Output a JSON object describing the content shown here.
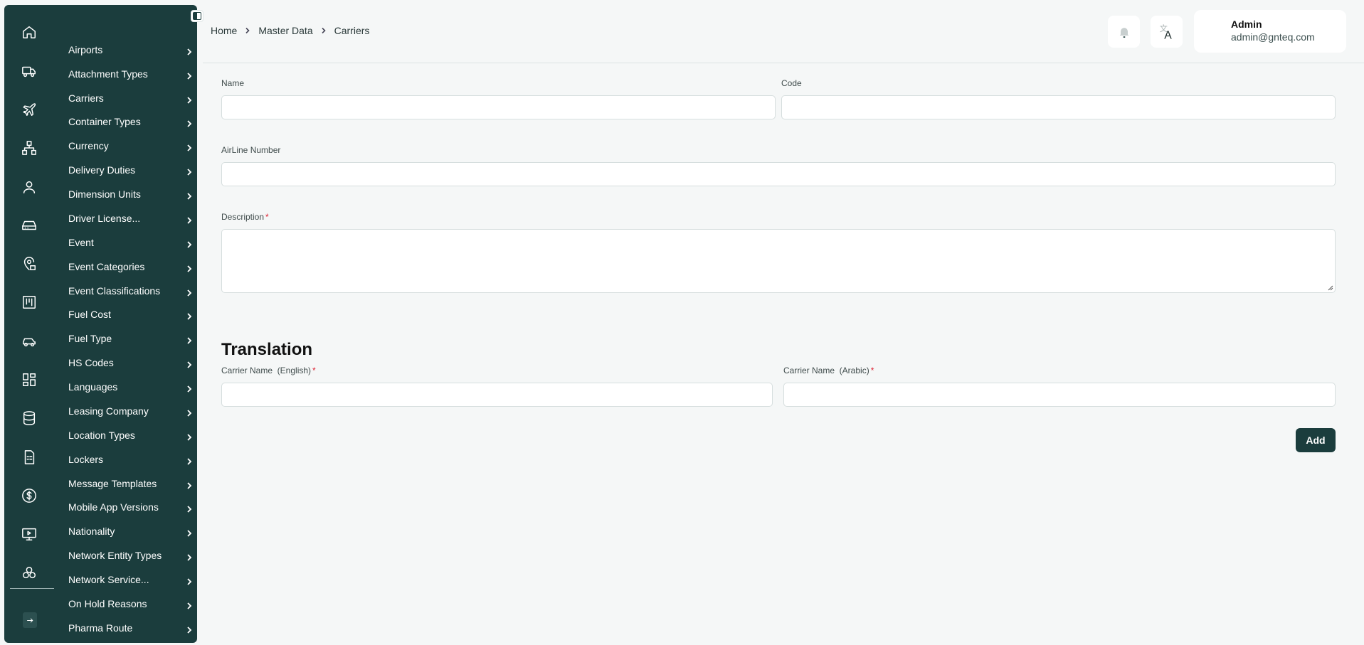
{
  "breadcrumb": {
    "home": "Home",
    "section": "Master Data",
    "current": "Carriers"
  },
  "user": {
    "name": "Admin",
    "email": "admin@gnteq.com"
  },
  "header": {
    "bell_icon": "bell-icon",
    "translate_icon": "translate-icon"
  },
  "sidebar": {
    "rail_icons": [
      "home-icon",
      "truck-icon",
      "plane-icon",
      "network-icon",
      "user-icon",
      "drive-icon",
      "location-pin-icon",
      "kanban-icon",
      "car-icon",
      "grid-icon",
      "database-icon",
      "document-icon",
      "dollar-icon",
      "monitor-icon",
      "cogs-icon",
      "logout-icon"
    ],
    "menu": [
      "Airports",
      "Attachment Types",
      "Carriers",
      "Container Types",
      "Currency",
      "Delivery Duties",
      "Dimension Units",
      "Driver License...",
      "Event",
      "Event Categories",
      "Event Classifications",
      "Fuel Cost",
      "Fuel Type",
      "HS Codes",
      "Languages",
      "Leasing Company",
      "Location Types",
      "Lockers",
      "Message Templates",
      "Mobile App Versions",
      "Nationality",
      "Network Entity Types",
      "Network Service...",
      "On Hold Reasons",
      "Pharma Route"
    ]
  },
  "form": {
    "name_label": "Name",
    "name_value": "",
    "code_label": "Code",
    "code_value": "",
    "airline_label": "AirLine Number",
    "airline_value": "",
    "description_label": "Description",
    "description_value": "",
    "required_mark": "*"
  },
  "translation": {
    "title": "Translation",
    "english_label": "Carrier Name  (English)",
    "english_value": "",
    "arabic_label": "Carrier Name  (Arabic)",
    "arabic_value": ""
  },
  "actions": {
    "add_label": "Add"
  },
  "colors": {
    "sidebar_bg": "#1b3d3d",
    "page_bg": "#f5f7f7",
    "required": "#dd2233"
  }
}
